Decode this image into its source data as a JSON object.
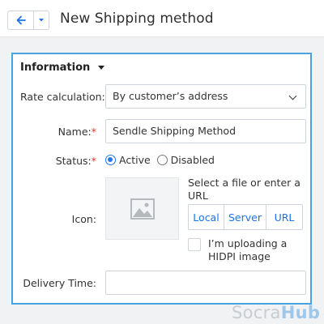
{
  "header": {
    "title": "New Shipping method",
    "back_icon": "arrow-left-icon",
    "dropdown_icon": "caret-down-icon"
  },
  "section": {
    "title": "Information"
  },
  "form": {
    "rate_calculation": {
      "label": "Rate calculation:",
      "value": "By customer’s address"
    },
    "name": {
      "label": "Name:",
      "required_mark": "*",
      "value": "Sendle Shipping Method"
    },
    "status": {
      "label": "Status:",
      "required_mark": "*",
      "options": [
        "Active",
        "Disabled"
      ],
      "selected": "Active"
    },
    "icon": {
      "label": "Icon:",
      "help": "Select a file or enter a URL",
      "sources": [
        "Local",
        "Server",
        "URL"
      ],
      "hidpi_label": "I’m uploading a HIDPI image",
      "hidpi_checked": false
    },
    "delivery_time": {
      "label": "Delivery Time:",
      "value": ""
    }
  },
  "watermark": {
    "part1": "Socra",
    "part2": "Hub"
  },
  "colors": {
    "accent": "#4aa3df",
    "link": "#1a73e8",
    "required": "#e0352b"
  }
}
